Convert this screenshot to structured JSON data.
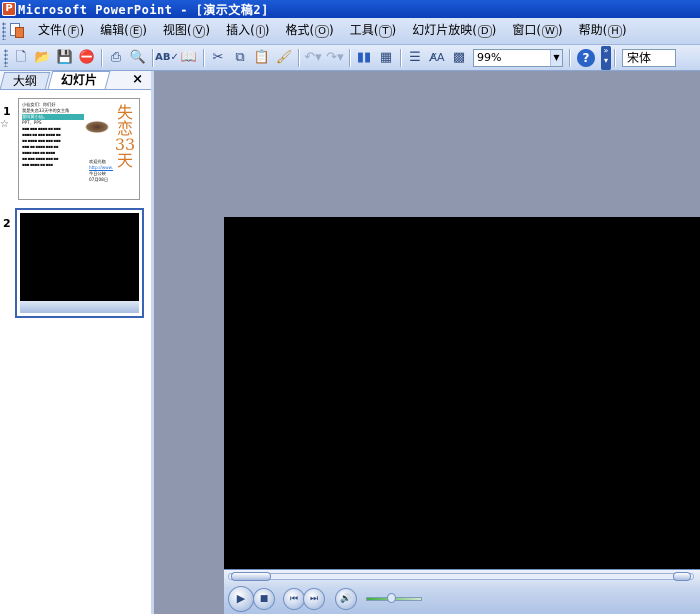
{
  "window": {
    "title": "Microsoft PowerPoint - [演示文稿2]",
    "app_icon": "powerpoint-icon"
  },
  "menu": {
    "items": [
      {
        "label": "文件",
        "accel": "F"
      },
      {
        "label": "编辑",
        "accel": "E"
      },
      {
        "label": "视图",
        "accel": "V"
      },
      {
        "label": "插入",
        "accel": "I"
      },
      {
        "label": "格式",
        "accel": "O"
      },
      {
        "label": "工具",
        "accel": "T"
      },
      {
        "label": "幻灯片放映",
        "accel": "D"
      },
      {
        "label": "窗口",
        "accel": "W"
      },
      {
        "label": "帮助",
        "accel": "H"
      }
    ]
  },
  "toolbar": {
    "zoom": "99%",
    "font": "宋体",
    "icons": [
      "new-icon",
      "open-icon",
      "save-icon",
      "permission-icon",
      "print-icon",
      "print-preview-icon",
      "spelling-icon",
      "research-icon",
      "cut-icon",
      "copy-icon",
      "paste-icon",
      "format-painter-icon",
      "undo-icon",
      "redo-icon",
      "insert-chart-icon",
      "insert-table-icon",
      "expand-icon",
      "show-formatting-icon",
      "grid-icon",
      "help-icon"
    ]
  },
  "left_pane": {
    "tabs": [
      "大纲",
      "幻灯片"
    ],
    "active_tab": "幻灯片",
    "close": "×",
    "slides": [
      {
        "number": "1",
        "title": "失恋33天",
        "text_lines": [
          "小仙女们：你们好",
          "我是失恋33天中的女主角",
          "我叫黄小仙。",
          "PPT、PPS"
        ],
        "footer_lines": [
          "欢迎光临",
          "http://www.",
          "今日公映",
          "07月08日"
        ]
      },
      {
        "number": "2"
      }
    ]
  },
  "player": {
    "buttons": [
      "play-icon",
      "stop-icon",
      "previous-icon",
      "next-icon",
      "mute-icon"
    ],
    "volume": 0.45
  }
}
